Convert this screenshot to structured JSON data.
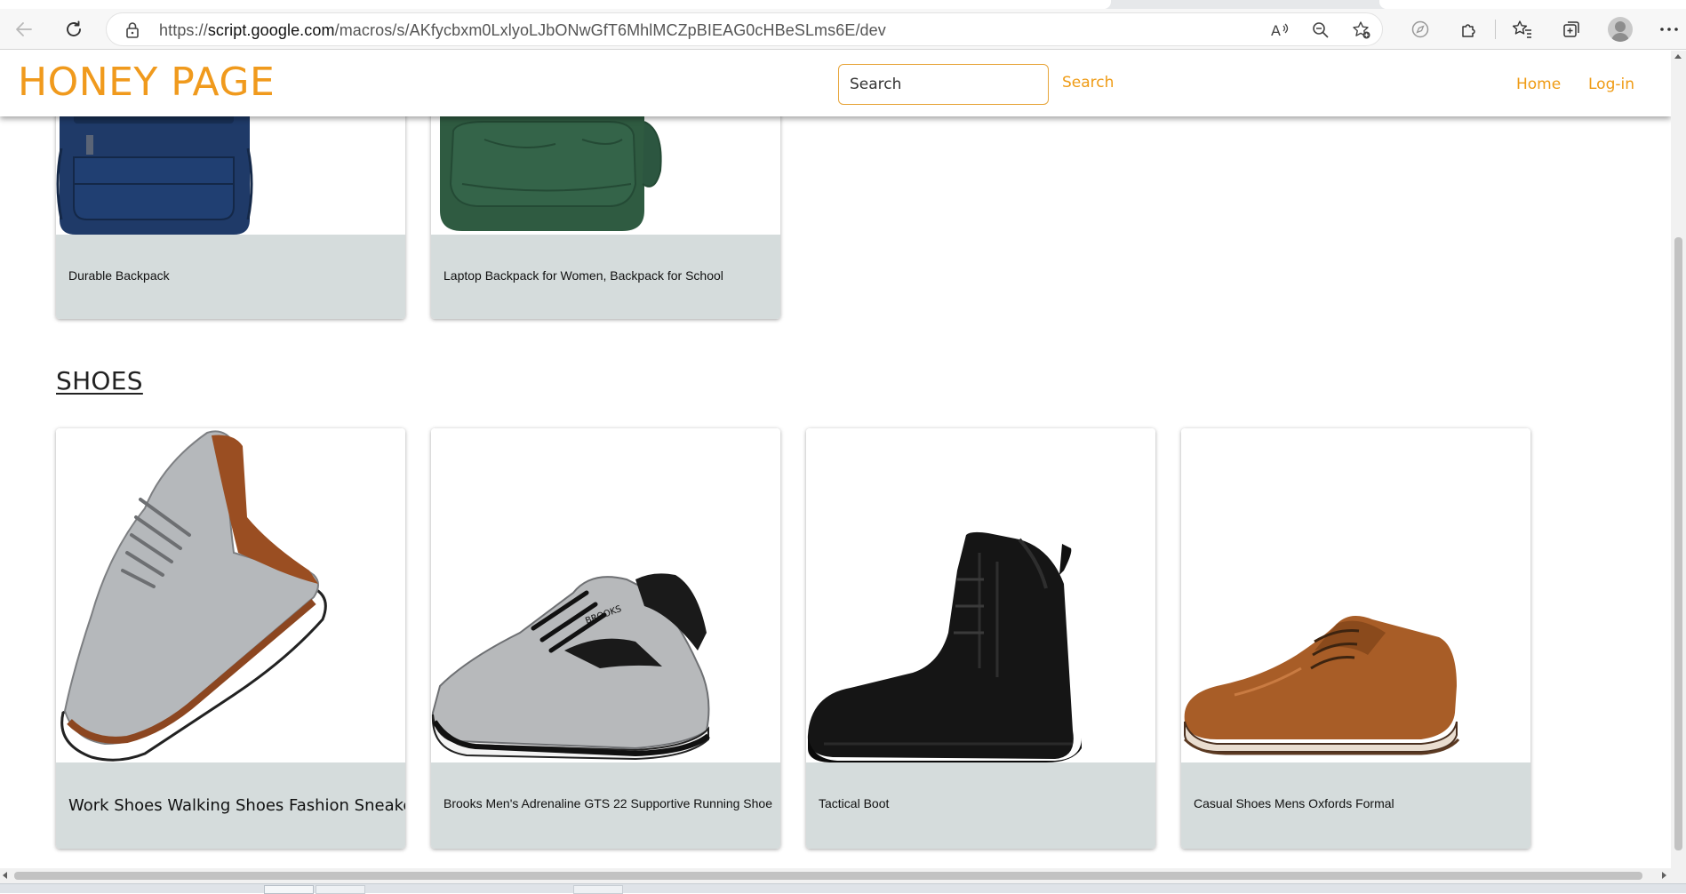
{
  "browser": {
    "url_scheme": "https://",
    "url_host": "script.google.com",
    "url_path": "/macros/s/AKfycbxm0LxlyoLJbONwGfT6MhlMCZpBIEAG0cHBeSLms6E/dev"
  },
  "header": {
    "brand": "HONEY PAGE",
    "search_placeholder": "Search",
    "search_button": "Search",
    "nav": {
      "home": "Home",
      "login": "Log-in"
    }
  },
  "bags": {
    "items": [
      {
        "title": "Durable Backpack",
        "image": "blue-backpack",
        "color": "#1f3a68"
      },
      {
        "title": "Laptop Backpack for Women, Backpack for School",
        "image": "green-backpack",
        "color": "#2f5b41"
      }
    ]
  },
  "shoes": {
    "title": "SHOES",
    "items": [
      {
        "title": "Work Shoes Walking Shoes Fashion Sneakers",
        "image": "grey-knit-sneaker"
      },
      {
        "title": "Brooks Men's Adrenaline GTS 22 Supportive Running Shoe",
        "image": "grey-running-shoe"
      },
      {
        "title": "Tactical Boot",
        "image": "black-tactical-boot"
      },
      {
        "title": "Casual Shoes Mens Oxfords Formal",
        "image": "brown-oxford-shoe"
      }
    ]
  },
  "colors": {
    "accent": "#f09a1d",
    "caption_bg": "#d5dcdc"
  }
}
